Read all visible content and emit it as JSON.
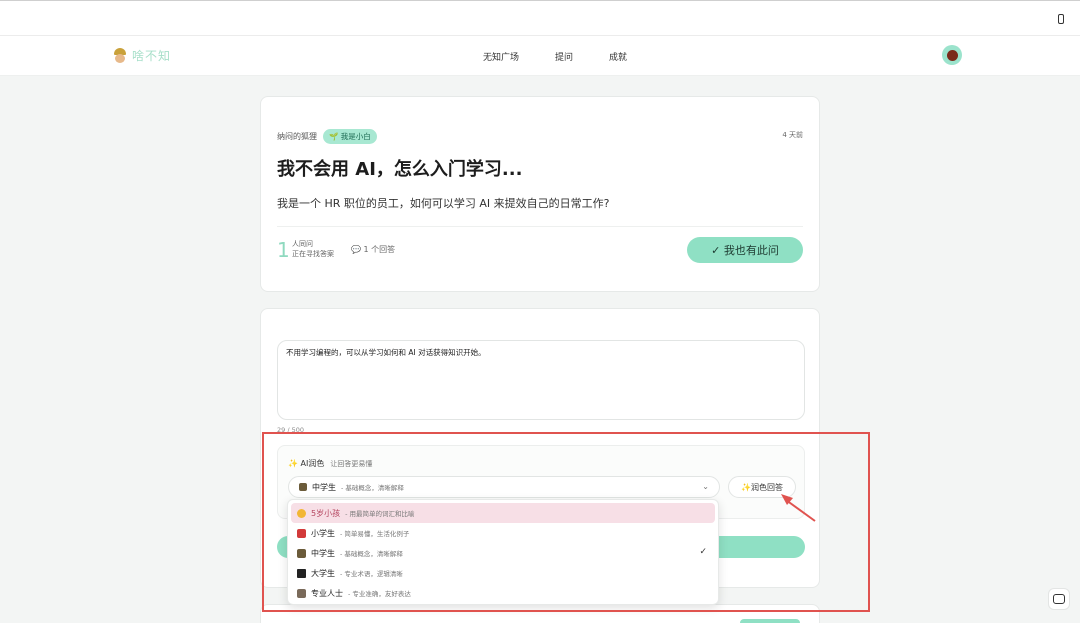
{
  "app": {
    "logo_text": "啥不知",
    "nav": [
      "无知广场",
      "提问",
      "成就"
    ]
  },
  "question": {
    "author": "纳闷的狐狸",
    "tag": "🌱 我是小白",
    "time": "4 天前",
    "title": "我不会用 AI，怎么入门学习...",
    "description": "我是一个 HR 职位的员工，如何可以学习 AI 来提效自己的日常工作?",
    "same_count": "1",
    "same_label_1": "人同问",
    "same_label_2": "正在寻找答案",
    "answers": "💬 1 个回答",
    "same_button": "✓ 我也有此问"
  },
  "answer": {
    "text": "不用学习编程的，可以从学习如何和 AI 对话获得知识开始。",
    "counter": "29 / 500",
    "ai_title": "✨ AI润色",
    "ai_sub": "让回答更易懂",
    "selected_level": "中学生",
    "selected_desc": "- 基础概念，清晰解释",
    "polish_button": "✨润色回答"
  },
  "dropdown_options": [
    {
      "label": "5岁小孩",
      "desc": "- 用最简单的词汇和比喻",
      "color": "#f2b635"
    },
    {
      "label": "小学生",
      "desc": "- 简单易懂，生活化例子",
      "color": "#d23a3a"
    },
    {
      "label": "中学生",
      "desc": "- 基础概念，清晰解释",
      "color": "#6b5b3a",
      "check": "✓"
    },
    {
      "label": "大学生",
      "desc": "- 专业术语，逻辑清晰",
      "color": "#222222"
    },
    {
      "label": "专业人士",
      "desc": "- 专业准确，友好表达",
      "color": "#7a6a5a"
    }
  ],
  "colors": {
    "accent": "#8fe0c4",
    "highlight_box": "#e0534f",
    "active_option": "#f7dfe6"
  }
}
